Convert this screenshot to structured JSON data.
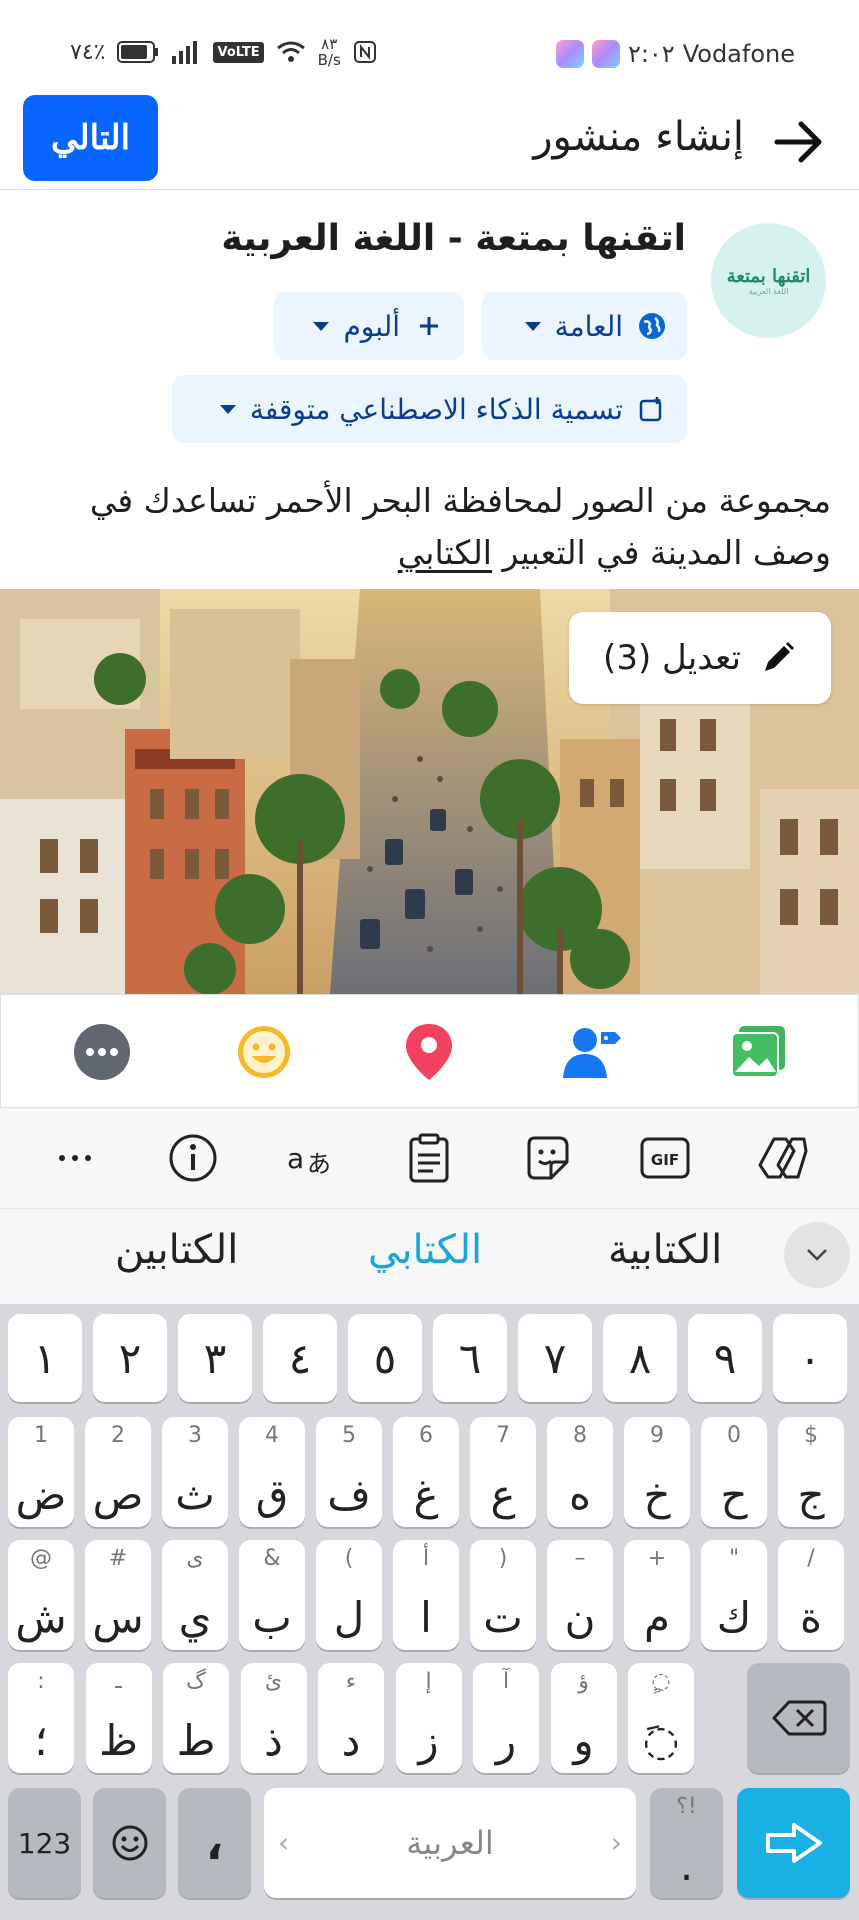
{
  "status_bar": {
    "carrier": "Vodafone",
    "time": "٢:٠٢",
    "battery": "٧٤٪",
    "network_speed": "٨٣\nB/s",
    "volte": "VoLTE"
  },
  "header": {
    "title": "إنشاء منشور",
    "next_label": "التالي"
  },
  "page": {
    "name": "اتقنها بمتعة - اللغة  العربية",
    "avatar_text": "اتقنها بمتعة",
    "avatar_subtext": "اللغة العربية"
  },
  "chips": {
    "audience": "العامة",
    "album": "ألبوم",
    "ai_label": "تسمية الذكاء الاصطناعي متوقفة"
  },
  "post": {
    "text_main": "مجموعة من الصور لمحافظة البحر الأحمر تساعدك في وصف المدينة في التعبير ",
    "text_underlined": "الكتابي"
  },
  "photo": {
    "edit_label": "تعديل (3)"
  },
  "keyboard": {
    "suggestions": [
      "الكتابية",
      "الكتابي",
      "الكتابين"
    ],
    "active_suggestion_color": "#19a7d6",
    "number_row": [
      "١",
      "٢",
      "٣",
      "٤",
      "٥",
      "٦",
      "٧",
      "٨",
      "٩",
      "٠"
    ],
    "row1": [
      {
        "k": "ض",
        "h": "1"
      },
      {
        "k": "ص",
        "h": "2"
      },
      {
        "k": "ث",
        "h": "3"
      },
      {
        "k": "ق",
        "h": "4"
      },
      {
        "k": "ف",
        "h": "5"
      },
      {
        "k": "غ",
        "h": "6"
      },
      {
        "k": "ع",
        "h": "7"
      },
      {
        "k": "ه",
        "h": "8"
      },
      {
        "k": "خ",
        "h": "9"
      },
      {
        "k": "ح",
        "h": "0"
      },
      {
        "k": "ج",
        "h": "$"
      }
    ],
    "row2": [
      {
        "k": "ش",
        "h": "@"
      },
      {
        "k": "س",
        "h": "#"
      },
      {
        "k": "ي",
        "h": "ى"
      },
      {
        "k": "ب",
        "h": "&"
      },
      {
        "k": "ل",
        "h": "("
      },
      {
        "k": "ا",
        "h": "أ"
      },
      {
        "k": "ت",
        "h": ")"
      },
      {
        "k": "ن",
        "h": "–"
      },
      {
        "k": "م",
        "h": "+"
      },
      {
        "k": "ك",
        "h": "\""
      },
      {
        "k": "ة",
        "h": "/"
      }
    ],
    "row3": [
      {
        "k": "؛",
        "h": ":"
      },
      {
        "k": "ظ",
        "h": "ـ"
      },
      {
        "k": "ط",
        "h": "گ"
      },
      {
        "k": "ذ",
        "h": "ئ"
      },
      {
        "k": "د",
        "h": "ء"
      },
      {
        "k": "ز",
        "h": "إ"
      },
      {
        "k": "ر",
        "h": "آ"
      },
      {
        "k": "و",
        "h": "ؤ"
      },
      {
        "k": "◌َ",
        "h": "◌ٍ"
      }
    ],
    "num_key": "123",
    "comma_key": "،",
    "space_label": "العربية",
    "punct_hint": "؟!",
    "punct_main": "."
  },
  "icons": {
    "back": "arrow-right-icon",
    "globe": "globe-icon",
    "plus": "plus-icon",
    "ai": "ai-label-icon",
    "pencil": "pencil-icon",
    "photo": "photo-icon",
    "tag": "tag-people-icon",
    "location": "location-icon",
    "emoji": "emoji-icon",
    "more": "more-icon"
  }
}
